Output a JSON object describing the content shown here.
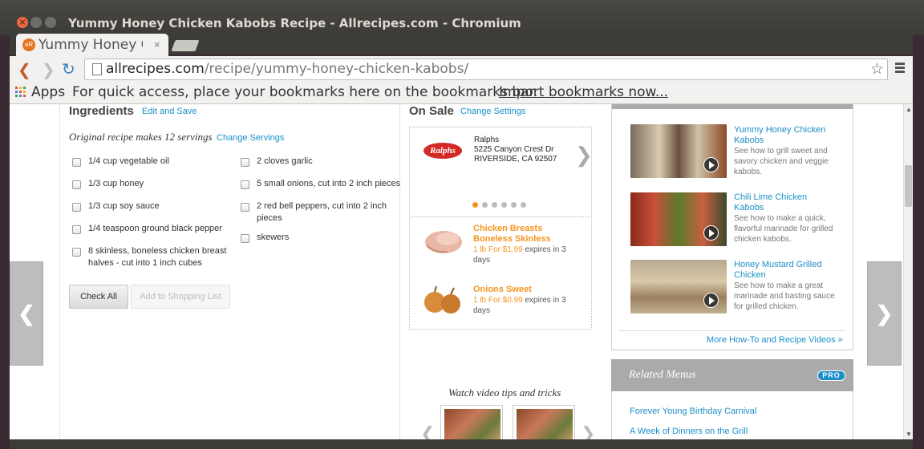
{
  "window": {
    "title": "Yummy Honey Chicken Kabobs Recipe - Allrecipes.com - Chromium",
    "close_glyph": "×"
  },
  "tab": {
    "favicon_text": "aR",
    "title": "Yummy Honey Ch",
    "close_glyph": "×"
  },
  "toolbar": {
    "back_glyph": "❮",
    "forward_glyph": "❯",
    "reload_glyph": "↻",
    "url_host": "allrecipes.com",
    "url_path": "/recipe/yummy-honey-chicken-kabobs/",
    "star_glyph": "☆"
  },
  "bookmarks": {
    "apps_label": "Apps",
    "message": "For quick access, place your bookmarks here on the bookmarks bar.",
    "import_link": "Import bookmarks now..."
  },
  "ingredients": {
    "title": "Ingredients",
    "edit_link": "Edit and Save",
    "servings_text": "Original recipe makes 12 servings",
    "change_servings": "Change Servings",
    "left": [
      "1/4 cup vegetable oil",
      "1/3 cup honey",
      "1/3 cup soy sauce",
      "1/4 teaspoon ground black pepper",
      "8 skinless, boneless chicken breast halves - cut into 1 inch cubes"
    ],
    "right": [
      "2 cloves garlic",
      "5 small onions, cut into 2 inch pieces",
      "2 red bell peppers, cut into 2 inch pieces",
      "skewers"
    ],
    "check_all": "Check All",
    "add_to_list": "Add to Shopping List"
  },
  "on_sale": {
    "title": "On Sale",
    "change_settings": "Change Settings",
    "logo_text": "Ralphs",
    "store_name": "Ralphs",
    "store_address": "5225 Canyon Crest Dr",
    "store_city": "RIVERSIDE, CA 92507",
    "next_glyph": "❯",
    "products": [
      {
        "name": "Chicken Breasts Boneless Skinless",
        "price": "1 lb For $1.99",
        "expires": " expires in 3 days"
      },
      {
        "name": "Onions Sweet",
        "price": "1 lb For $0.99",
        "expires": " expires in 3 days"
      }
    ]
  },
  "videos": {
    "items": [
      {
        "title": "Yummy Honey Chicken Kabobs",
        "desc": "See how to grill sweet and savory chicken and veggie kabobs."
      },
      {
        "title": "Chili Lime Chicken Kabobs",
        "desc": "See how to make a quick, flavorful marinade for grilled chicken kabobs."
      },
      {
        "title": "Honey Mustard Grilled Chicken",
        "desc": "See how to make a great marinade and basting sauce for grilled chicken."
      }
    ],
    "more_link": "More How-To and Recipe Videos »",
    "caption": "Watch video tips and tricks"
  },
  "related": {
    "title": "Related Menus",
    "badge": "PRO",
    "links": [
      "Forever Young Birthday Carnival",
      "A Week of Dinners on the Grill"
    ]
  },
  "carousel": {
    "prev_glyph": "❮",
    "next_glyph": "❯"
  },
  "colors": {
    "link": "#1b8fc9",
    "sale_orange": "#f5951f",
    "ralphs_red": "#d32a26"
  }
}
